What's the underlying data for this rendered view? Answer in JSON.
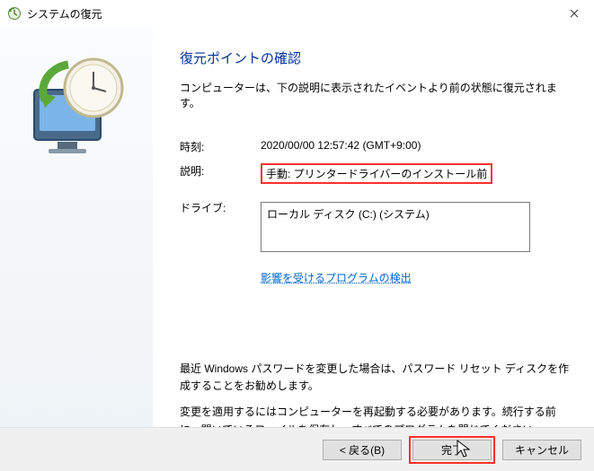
{
  "window": {
    "title": "システムの復元"
  },
  "main": {
    "heading": "復元ポイントの確認",
    "subline": "コンピューターは、下の説明に表示されたイベントより前の状態に復元されます。",
    "rows": {
      "time_label": "時刻:",
      "time_value": "2020/00/00 12:57:42 (GMT+9:00)",
      "desc_label": "説明:",
      "desc_value": "手動: プリンタードライバーのインストール前",
      "drive_label": "ドライブ:",
      "drive_value": "ローカル ディスク (C:) (システム)"
    },
    "scan_link": "影響を受けるプログラムの検出",
    "para1": "最近 Windows パスワードを変更した場合は、パスワード リセット ディスクを作成することをお勧めします。",
    "para2": "変更を適用するにはコンピューターを再起動する必要があります。続行する前に、開いているファイルを保存し、すべてのプログラムを閉じてください。"
  },
  "footer": {
    "back": "< 戻る(B)",
    "finish": "完了",
    "cancel": "キャンセル"
  }
}
